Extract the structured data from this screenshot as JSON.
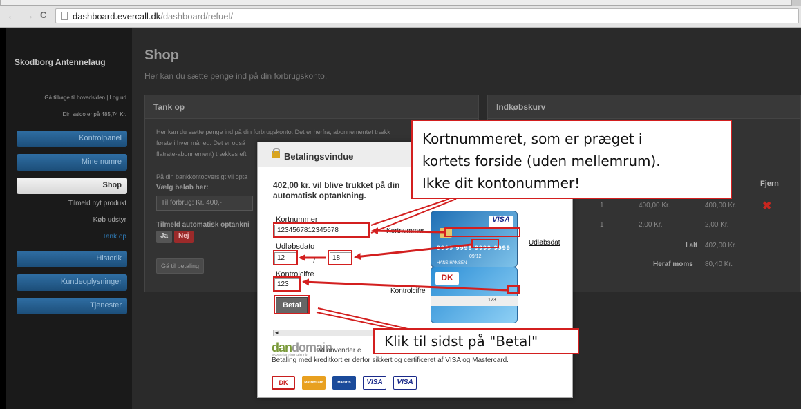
{
  "browser": {
    "url_host": "dashboard.evercall.dk",
    "url_path": "/dashboard/refuel/",
    "back_glyph": "←",
    "forward_glyph": "→",
    "reload_glyph": "C"
  },
  "sidebar": {
    "brand": "Skodborg Antennelaug",
    "top_links": "Gå tilbage til hovedsiden | Log ud",
    "balance": "Din saldo er på 485,74 Kr.",
    "items": [
      {
        "label": "Kontrolpanel"
      },
      {
        "label": "Mine numre"
      },
      {
        "label": "Shop"
      },
      {
        "label": "Historik"
      },
      {
        "label": "Kundeoplysninger"
      },
      {
        "label": "Tjenester"
      }
    ],
    "sub_items": [
      {
        "label": "Tilmeld nyt produkt"
      },
      {
        "label": "Køb udstyr"
      },
      {
        "label": "Tank op"
      }
    ]
  },
  "main": {
    "title": "Shop",
    "description": "Her kan du sætte penge ind på din forbrugskonto."
  },
  "tank_panel": {
    "title": "Tank op",
    "text_lines": [
      "Her kan du sætte penge ind på din forbrugskonto. Det er herfra, abonnementet trækk",
      "første i hver måned. Det er også",
      "flatrate-abonnement) trækkes eft"
    ],
    "bank_text": "På din bankkontooversigt vil opta",
    "amount_label": "Vælg beløb her:",
    "amount_value": "Til forbrug: Kr. 400,-",
    "auto_label": "Tilmeld automatisk optankni",
    "toggle_yes": "Ja",
    "toggle_no": "Nej",
    "pay_button": "Gå til betaling"
  },
  "cart_panel": {
    "title": "Indkøbskurv",
    "remove_header": "Fjern",
    "rows": [
      {
        "qty": "1",
        "price": "400,00 Kr.",
        "total": "400,00 Kr."
      },
      {
        "qty": "1",
        "price": "2,00 Kr.",
        "total": "2,00 Kr."
      }
    ],
    "total_label": "I alt",
    "total_value": "402,00 Kr.",
    "vat_label": "Heraf moms",
    "vat_value": "80,40 Kr.",
    "remove_glyph": "✖"
  },
  "modal": {
    "title": "Betalingsvindue",
    "amount_text": "402,00 kr. vil blive trukket på din automatisk optankning.",
    "card_number_label": "Kortnummer",
    "card_number_value": "1234567812345678",
    "expiry_label": "Udløbsdato",
    "expiry_month": "12",
    "expiry_year": "18",
    "slash": "/",
    "cvc_label": "Kontrolcifre",
    "cvc_value": "123",
    "pay_button": "Betal",
    "scroll_glyph": "◂",
    "dd_logo_dan": "dan",
    "dd_logo_domain": "domain",
    "dd_logo_sub": "www.dandomain.dk",
    "dd_text": "Vi anvender e",
    "secure_text": "Betaling med kreditkort er derfor sikkert og certificeret af",
    "secure_visa": "VISA",
    "secure_and": "og",
    "secure_mc": "Mastercard",
    "payment_cards": [
      "DK",
      "MasterCard",
      "Maestro",
      "VISA",
      "VISA"
    ],
    "card_labels": {
      "number": "Kortnummer",
      "expiry": "Udløbsdat",
      "cvc": "Kontrolcifre"
    },
    "card_visa": {
      "brand": "VISA",
      "number": "9999 9999 9999 9999",
      "expiry": "09/12",
      "name": "HANS HANSEN"
    },
    "card_dk": {
      "brand": "DK",
      "cvc": "123"
    }
  },
  "callouts": {
    "card_number_hint": [
      "Kortnummeret, som er præget i",
      "kortets forside (uden mellemrum).",
      "Ikke dit kontonummer!"
    ],
    "pay_hint": "Klik til sidst på \"Betal\""
  },
  "colors": {
    "annotation_red": "#d31f1f",
    "sidebar_blue": "#2f6ea3",
    "remove_red": "#c8261f"
  }
}
